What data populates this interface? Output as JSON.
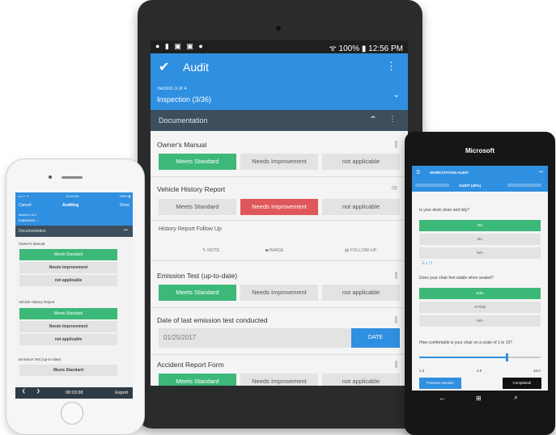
{
  "tablet": {
    "status_left": "● ▮ ▣ ▣ ●",
    "status_right": "ᯤ 100% ▮ 12:56 PM",
    "title": "Audit",
    "check_icon": "check-icon",
    "kebab": "⋮",
    "section_small": "Section 3 of 4",
    "section_title": "Inspection (3/36)",
    "section_chevron": "⌄",
    "doc_label": "Documentation",
    "doc_caret": "⌃",
    "questions": {
      "q1": "Owner's Manual",
      "q2": "Vehicle History Report",
      "q2_badge": "(3)",
      "q3": "History Report Follow Up",
      "q4": "Emission Test (up-to-date)",
      "q5": "Date of last emission test conducted",
      "q6": "Accident Report Form"
    },
    "options": {
      "meets": "Meets Standard",
      "needs": "Needs Improvement",
      "na": "not applicable"
    },
    "followup": {
      "note": "NOTE",
      "image": "IMAGE",
      "follow": "FOLLOW-UP"
    },
    "date_value": "01/25/2017",
    "date_button": "DATE"
  },
  "iphone": {
    "status_left": "•••○○ ᯤ",
    "status_time": "11:45 AM",
    "status_right": "100% ▮",
    "cancel": "Cancel",
    "title": "Auditing",
    "done": "Done",
    "section_small": "Section 3 of 5",
    "section_title": "Inspection ⌄",
    "doc_label": "Documentation",
    "doc_dots": "•••",
    "q1": "Owner's Manual",
    "q2": "Vehicle History Report",
    "q3": "Emission Test (up-to-date)",
    "opt_meets": "Meets Standard",
    "opt_needs": "Needs Improvement",
    "opt_na": "not applicable",
    "timer": "00:03:38",
    "export": "Export",
    "back": "❮",
    "forward": "❯"
  },
  "winphone": {
    "brand": "Microsoft",
    "header": "WORKSTATION AUDIT",
    "tab_progress": "AUDIT (40%)",
    "q1": "Is your desk clean and tidy?",
    "q1_opts": [
      "Yes",
      "No",
      "N/A"
    ],
    "note": "☰ 1 ❐",
    "q2": "Does your chair feel stable when seated?",
    "q2_opts": [
      "Safe",
      "At Risk",
      "N/A"
    ],
    "q3": "How comfortable is your chair on a scale of 1 to 10?",
    "slider_min": "1.0",
    "slider_mid": "4.0",
    "slider_max": "10.0",
    "slider_value_fraction": 0.72,
    "prev_button": "Previous Section",
    "complete_button": "Completed!",
    "nav_back": "←",
    "nav_search": "⌕"
  },
  "colors": {
    "blue": "#2f8fe0",
    "green": "#3cb878",
    "red": "#e0575a",
    "dark": "#3d4f5c"
  }
}
